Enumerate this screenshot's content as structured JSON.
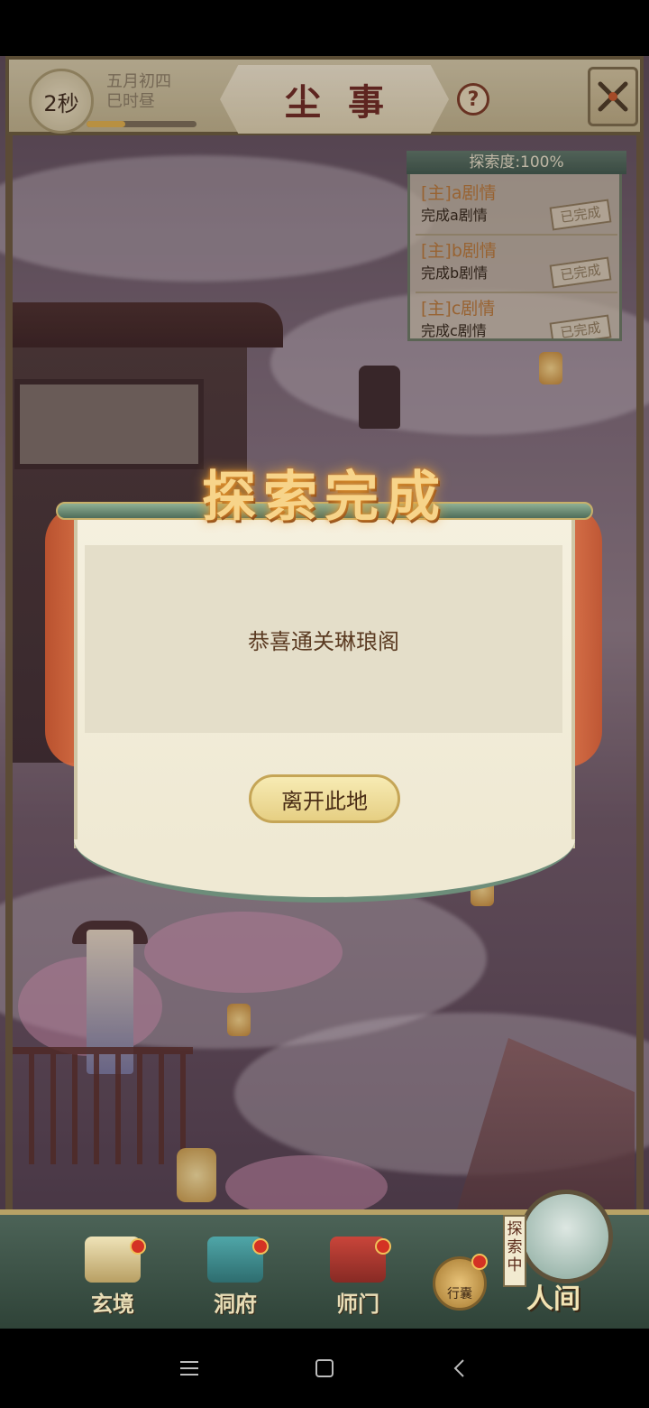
{
  "top_bar": {
    "timer": "2秒",
    "date_line1": "五月初四",
    "date_line2": "巳时昼",
    "time_progress": 0.35,
    "title": "尘事",
    "help_label": "?"
  },
  "quest_panel": {
    "header": "探索度:100%",
    "items": [
      {
        "title": "[主]a剧情",
        "desc": "完成a剧情",
        "status": "已完成"
      },
      {
        "title": "[主]b剧情",
        "desc": "完成b剧情",
        "status": "已完成"
      },
      {
        "title": "[主]c剧情",
        "desc": "完成c剧情",
        "status": "已完成"
      }
    ]
  },
  "dialog": {
    "title": "探索完成",
    "message": "恭喜通关琳琅阁",
    "button": "离开此地"
  },
  "bottom_nav": {
    "items": [
      {
        "label": "玄境"
      },
      {
        "label": "洞府"
      },
      {
        "label": "师门"
      }
    ],
    "bag_label": "行囊",
    "explore_tag": "探索中",
    "world_label": "人间"
  },
  "colors": {
    "accent_gold": "#f7d48a",
    "title_red": "#6e2a1f",
    "nav_green": "#4c6357",
    "badge_red": "#d43224"
  }
}
